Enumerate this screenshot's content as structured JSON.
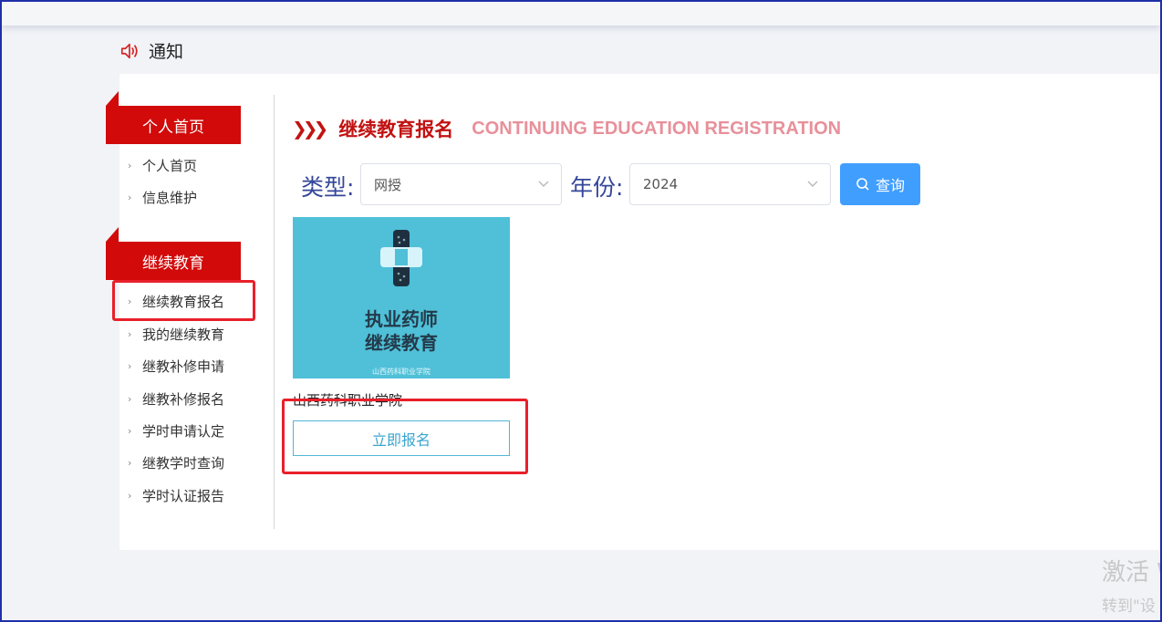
{
  "notice": {
    "label": "通知",
    "icon": "speaker-icon"
  },
  "sidebar": {
    "sections": [
      {
        "title": "个人首页",
        "items": [
          "个人首页",
          "信息维护"
        ]
      },
      {
        "title": "继续教育",
        "items": [
          "继续教育报名",
          "我的继续教育",
          "继教补修申请",
          "继教补修报名",
          "学时申请认定",
          "继教学时查询",
          "学时认证报告"
        ]
      }
    ],
    "highlighted_item": "继续教育报名"
  },
  "main": {
    "title_cn": "继续教育报名",
    "title_en": "CONTINUING EDUCATION REGISTRATION",
    "filters": {
      "type_label": "类型:",
      "type_value": "网授",
      "year_label": "年份:",
      "year_value": "2024",
      "query_label": "查询"
    },
    "card": {
      "image_title_1": "执业药师",
      "image_title_2": "继续教育",
      "image_small_text": "山西药科职业学院",
      "name": "山西药科职业学院",
      "register_label": "立即报名"
    }
  },
  "watermark": {
    "line1": "激活 W",
    "line2": "转到\"设"
  },
  "colors": {
    "accent_red": "#d20a0a",
    "primary_blue": "#409eff",
    "card_bg": "#4fc0d8",
    "highlight_box": "#e8202a"
  }
}
